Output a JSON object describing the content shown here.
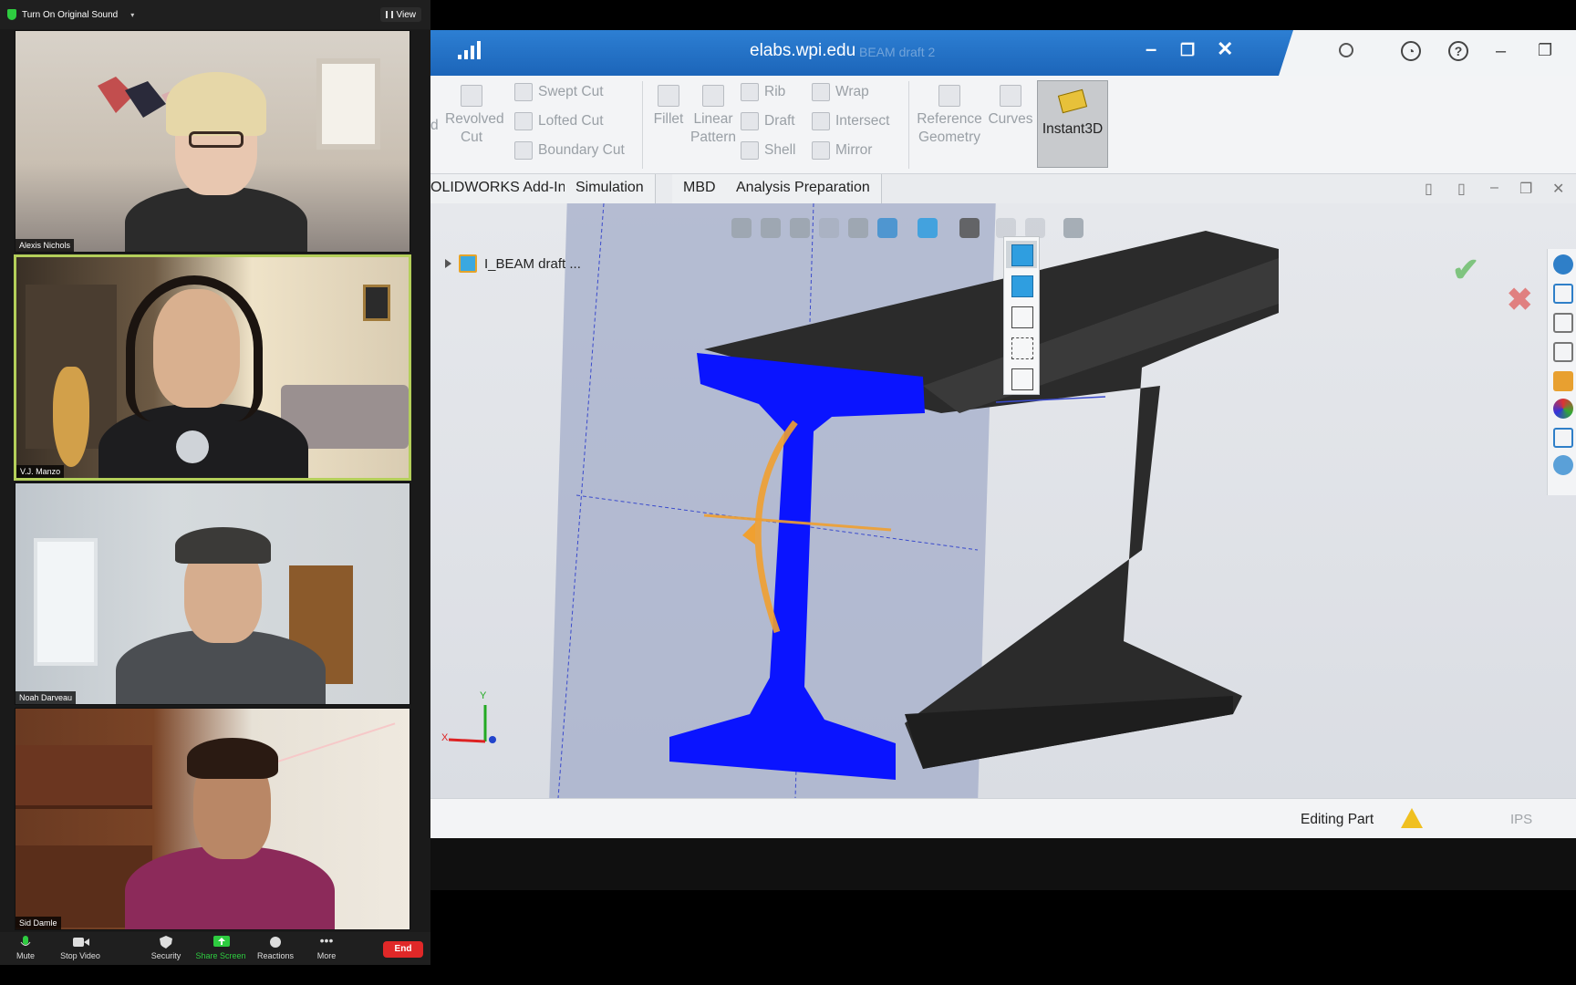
{
  "zoom": {
    "original_sound_label": "Turn On Original Sound",
    "view_label": "View",
    "participants": [
      {
        "name": "Alexis Nichols"
      },
      {
        "name": "V.J. Manzo"
      },
      {
        "name": "Noah Darveau"
      },
      {
        "name": "Sid Damle"
      }
    ],
    "toolbar": {
      "mute": "Mute",
      "stop_video": "Stop Video",
      "security": "Security",
      "share_screen": "Share Screen",
      "reactions": "Reactions",
      "more": "More",
      "end": "End"
    }
  },
  "solidworks": {
    "window_title": "elabs.wpi.edu",
    "ghost_title": "BEAM draft 2",
    "ribbon": {
      "revolved_cut": "Revolved Cut",
      "swept_cut": "Swept Cut",
      "lofted_cut": "Lofted Cut",
      "boundary_cut": "Boundary Cut",
      "fillet": "Fillet",
      "linear_pattern": "Linear Pattern",
      "rib": "Rib",
      "draft": "Draft",
      "shell": "Shell",
      "wrap": "Wrap",
      "intersect": "Intersect",
      "mirror": "Mirror",
      "reference_geometry": "Reference Geometry",
      "curves": "Curves",
      "instant3d": "Instant3D",
      "partial_d": "d"
    },
    "tabs": [
      "OLIDWORKS Add-Ins",
      "Simulation",
      "MBD",
      "Analysis Preparation"
    ],
    "feature_tree_item": "I_BEAM draft ...",
    "axis_labels": {
      "x": "X",
      "y": "Y"
    },
    "status": {
      "editing": "Editing Part",
      "units": "IPS"
    }
  },
  "colors": {
    "zoom_active_border": "#b4cf5a",
    "sw_title_blue": "#2d7fd3",
    "beam_face_blue": "#0a14ff",
    "beam_body": "#2b2b2b",
    "sketch_plane": "#9fa9c8",
    "triad_orange": "#f0a030",
    "end_red": "#e02828"
  }
}
